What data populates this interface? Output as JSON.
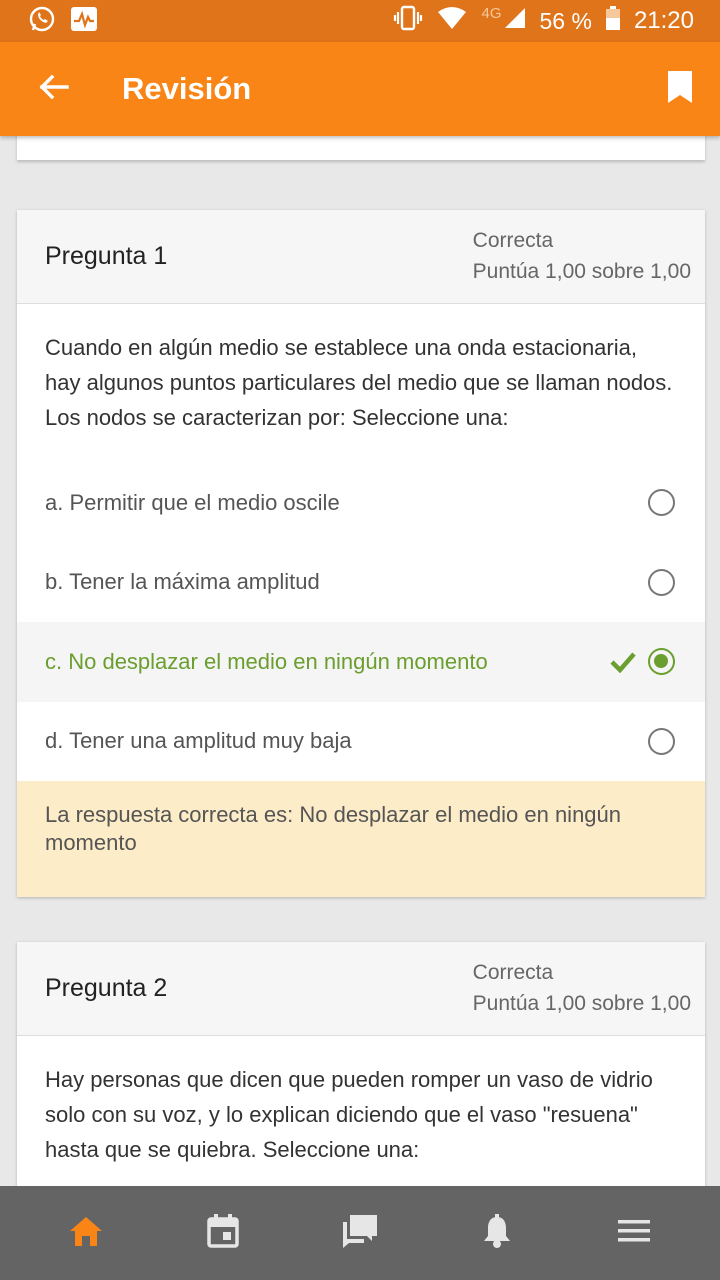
{
  "status_bar": {
    "network": "4G",
    "battery": "56 %",
    "time": "21:20",
    "icons": [
      "whatsapp-icon",
      "activity-icon",
      "vibrate-icon",
      "wifi-icon",
      "signal-icon",
      "battery-icon"
    ]
  },
  "app_bar": {
    "title": "Revisión",
    "back_icon": "arrow-left-icon",
    "bookmark_icon": "bookmark-icon"
  },
  "questions": [
    {
      "title": "Pregunta 1",
      "state": "Correcta",
      "grade": "Puntúa 1,00 sobre 1,00",
      "text": "Cuando en algún medio se establece una onda estacionaria, hay algunos puntos particulares del medio que se llaman nodos. Los nodos se caracterizan por: Seleccione una:",
      "options": [
        {
          "label": "a. Permitir que el medio oscile",
          "selected": false
        },
        {
          "label": "b. Tener la máxima amplitud",
          "selected": false
        },
        {
          "label": "c. No desplazar el medio en ningún momento",
          "selected": true,
          "correct": true
        },
        {
          "label": "d. Tener una amplitud muy baja",
          "selected": false
        }
      ],
      "feedback": "La respuesta correcta es: No desplazar el medio en ningún momento"
    },
    {
      "title": "Pregunta 2",
      "state": "Correcta",
      "grade": "Puntúa 1,00 sobre 1,00",
      "text": "Hay personas que dicen que pueden romper un vaso de vidrio solo con su voz, y lo explican diciendo que el vaso \"resuena\" hasta que se quiebra. Seleccione una:"
    }
  ],
  "bottom_nav": {
    "items": [
      "home-icon",
      "calendar-icon",
      "messages-icon",
      "notifications-icon",
      "menu-icon"
    ],
    "active": "home-icon"
  },
  "colors": {
    "status_bar": "#e0741b",
    "app_bar": "#f98517",
    "correct": "#6a9e2e",
    "feedback_bg": "#fdecc8",
    "bottom_nav": "#646464",
    "nav_active": "#f98517"
  }
}
